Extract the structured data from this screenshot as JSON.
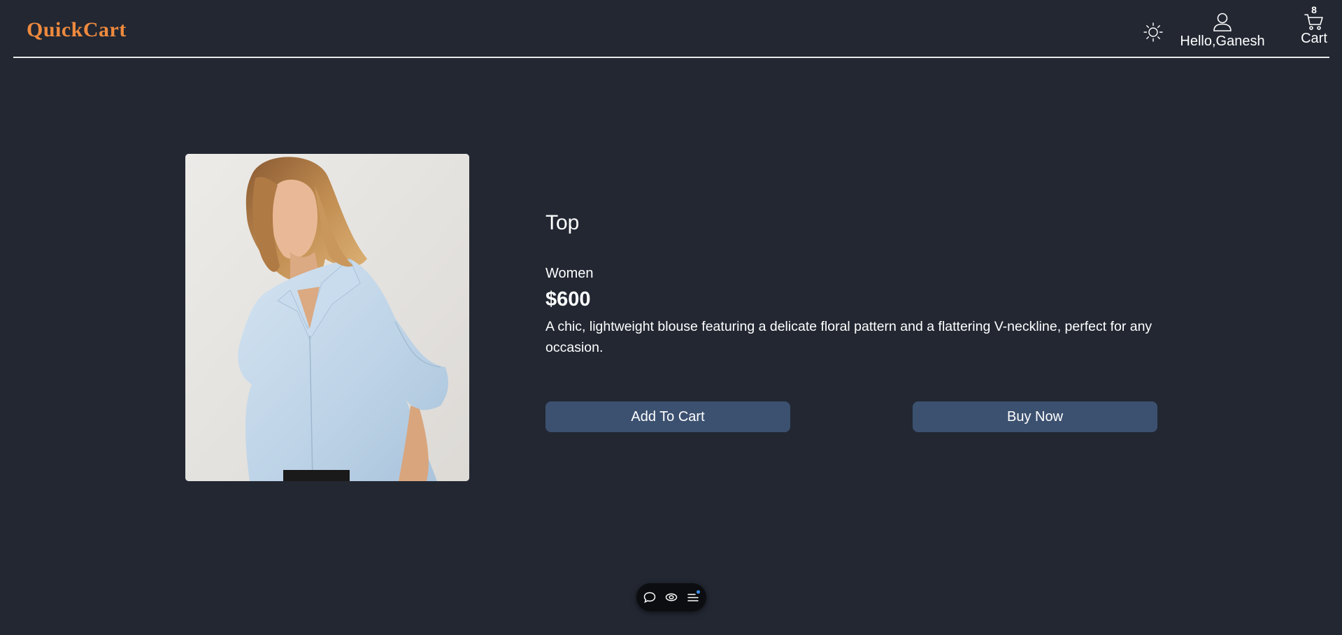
{
  "header": {
    "logo": "QuickCart",
    "theme_icon": "sun-icon",
    "user_icon": "user-icon",
    "user_greeting": "Hello,Ganesh",
    "cart_icon": "cart-icon",
    "cart_count": "8",
    "cart_label": "Cart"
  },
  "product": {
    "image_icon": "product-photo-blouse",
    "name": "Top",
    "category": "Women",
    "price": "$600",
    "description": "A chic, lightweight blouse featuring a delicate floral pattern and a flattering V-neckline, perfect for any occasion."
  },
  "actions": {
    "add_to_cart": "Add To Cart",
    "buy_now": "Buy Now"
  },
  "floating_toolbar": {
    "items": [
      "chat-icon",
      "eye-icon",
      "menu-icon"
    ]
  },
  "colors": {
    "background": "#222732",
    "brand": "#ef8a3e",
    "button": "#3c5170",
    "text": "#ffffff"
  }
}
